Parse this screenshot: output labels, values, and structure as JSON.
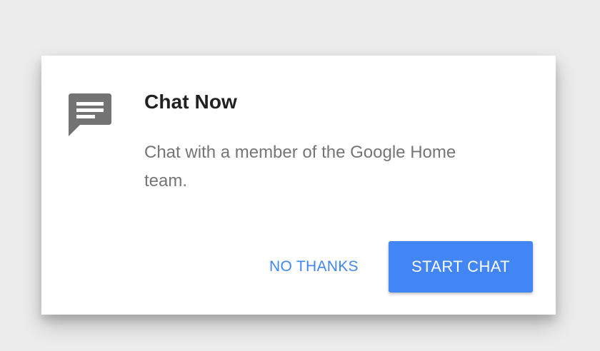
{
  "dialog": {
    "icon": "chat-bubble-icon",
    "title": "Chat Now",
    "message": "Chat with a member of the Google Home team.",
    "dismiss_label": "NO THANKS",
    "confirm_label": "START CHAT"
  },
  "colors": {
    "accent": "#4285f4",
    "icon": "#737373",
    "title": "#212121",
    "body": "#757575",
    "background": "#ececec"
  }
}
